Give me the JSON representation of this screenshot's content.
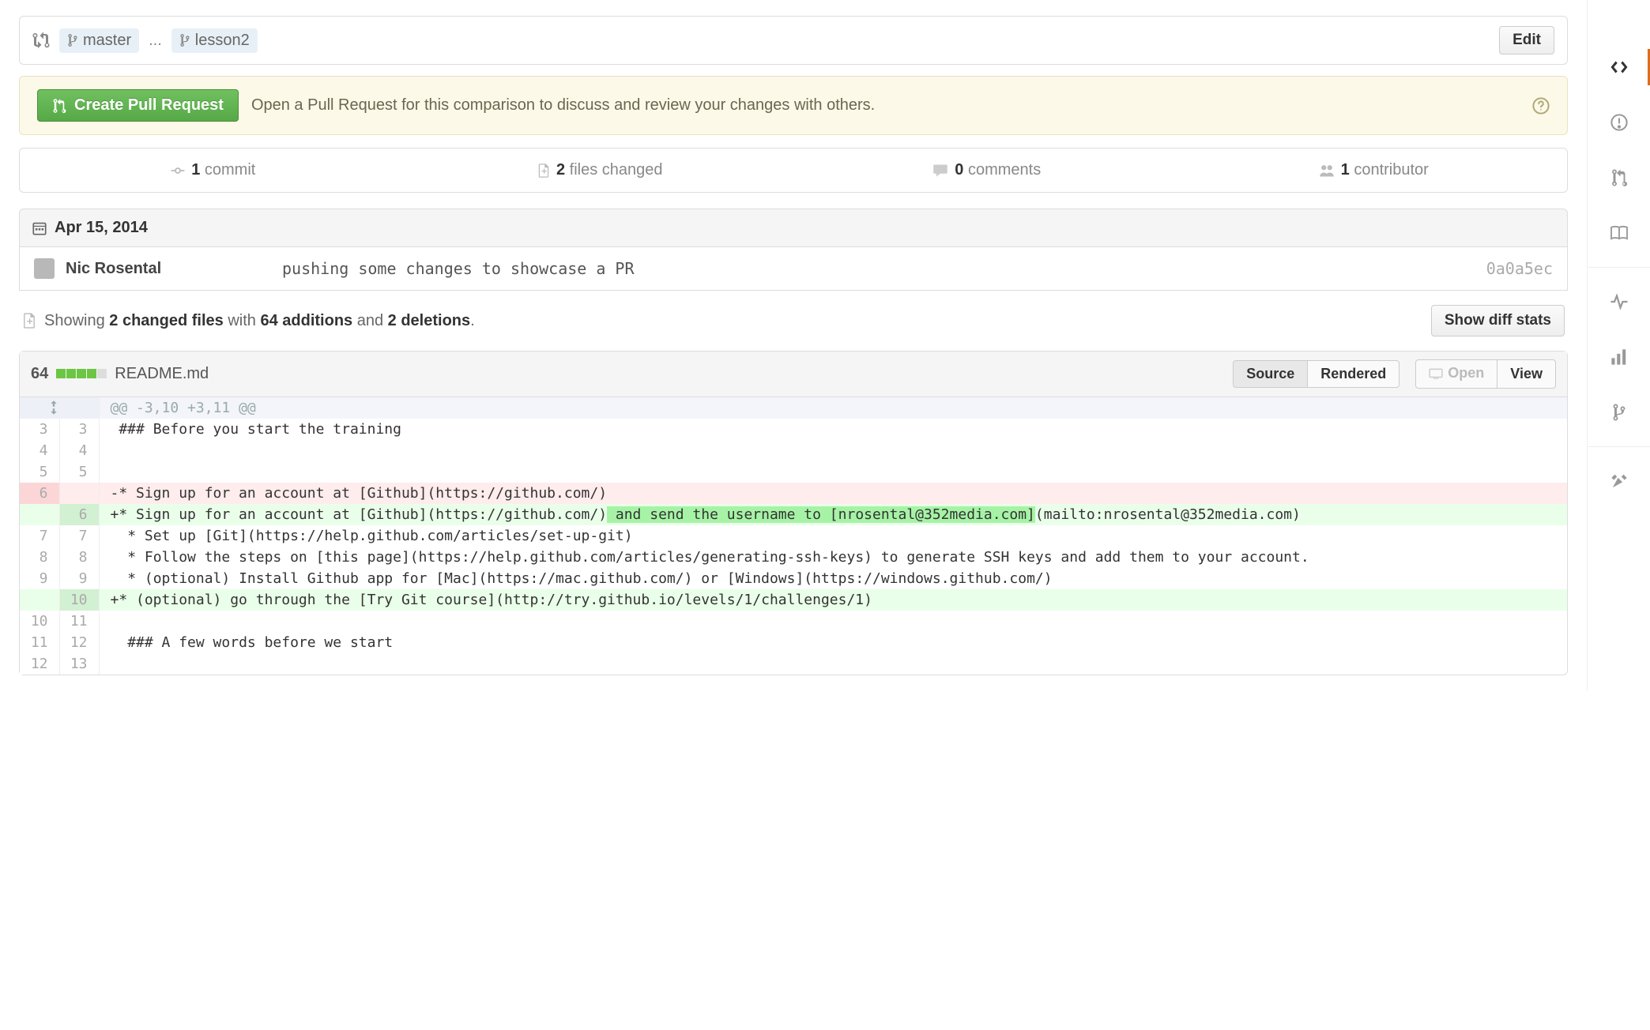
{
  "branchBar": {
    "base": "master",
    "compare": "lesson2",
    "edit": "Edit"
  },
  "prBox": {
    "button": "Create Pull Request",
    "text": "Open a Pull Request for this comparison to discuss and review your changes with others."
  },
  "stats": {
    "commits": {
      "count": "1",
      "label": " commit"
    },
    "files": {
      "count": "2",
      "label": " files changed"
    },
    "comments": {
      "count": "0",
      "label": " comments"
    },
    "contributors": {
      "count": "1",
      "label": " contributor"
    }
  },
  "dateHeader": "Apr 15, 2014",
  "commit": {
    "author": "Nic Rosental",
    "message": "pushing some changes to showcase a PR",
    "sha": "0a0a5ec"
  },
  "diffSummary": {
    "prefix": "Showing ",
    "files": "2 changed files",
    "with": " with ",
    "additions": "64 additions",
    "and": " and ",
    "deletions": "2 deletions",
    "dot": "."
  },
  "showStats": "Show diff stats",
  "fileHeader": {
    "count": "64",
    "name": "README.md",
    "source": "Source",
    "rendered": "Rendered",
    "open": "Open",
    "view": "View"
  },
  "diff": {
    "hunk": "@@ -3,10 +3,11 @@",
    "lines": [
      {
        "old": "3",
        "new": "3",
        "type": "ctx",
        "text": "### Before you start the training"
      },
      {
        "old": "4",
        "new": "4",
        "type": "ctx",
        "text": ""
      },
      {
        "old": "5",
        "new": "5",
        "type": "ctx",
        "text": ""
      },
      {
        "old": "6",
        "new": "",
        "type": "del",
        "prefix": "-",
        "text": "* Sign up for an account at [Github](https://github.com/)"
      },
      {
        "old": "",
        "new": "6",
        "type": "add",
        "prefix": "+",
        "text": "* Sign up for an account at [Github](https://github.com/)",
        "hlText": " and send the username to [nrosental@352media.com]",
        "text2": "(mailto:nrosental@352media.com)"
      },
      {
        "old": "7",
        "new": "7",
        "type": "ctx",
        "text": " * Set up [Git](https://help.github.com/articles/set-up-git)"
      },
      {
        "old": "8",
        "new": "8",
        "type": "ctx",
        "text": " * Follow the steps on [this page](https://help.github.com/articles/generating-ssh-keys) to generate SSH keys and add them to your account."
      },
      {
        "old": "9",
        "new": "9",
        "type": "ctx",
        "text": " * (optional) Install Github app for [Mac](https://mac.github.com/) or [Windows](https://windows.github.com/)"
      },
      {
        "old": "",
        "new": "10",
        "type": "add",
        "prefix": "+",
        "text": "* (optional) go through the [Try Git course](http://try.github.io/levels/1/challenges/1)"
      },
      {
        "old": "10",
        "new": "11",
        "type": "ctx",
        "text": ""
      },
      {
        "old": "11",
        "new": "12",
        "type": "ctx",
        "text": " ### A few words before we start"
      },
      {
        "old": "12",
        "new": "13",
        "type": "ctx",
        "text": ""
      }
    ]
  }
}
